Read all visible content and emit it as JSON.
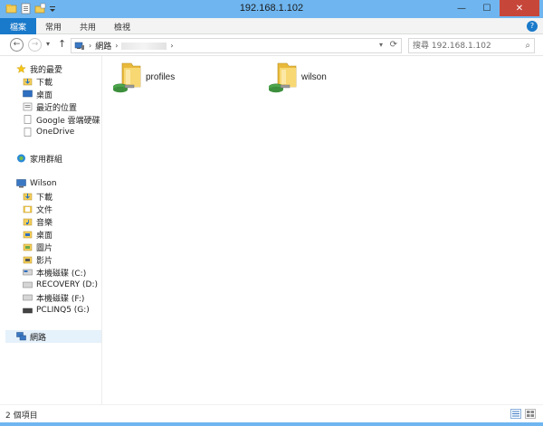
{
  "window": {
    "title": "192.168.1.102",
    "minimize": "—",
    "maximize": "☐",
    "close": "✕"
  },
  "ribbon": {
    "tabs": [
      "檔案",
      "常用",
      "共用",
      "檢視"
    ],
    "help": "?"
  },
  "navbar": {
    "back": "←",
    "forward": "→",
    "recent": "▾",
    "up": "↑",
    "address_root": "網路",
    "chevron": "›",
    "search_placeholder": "搜尋 192.168.1.102"
  },
  "sidebar": {
    "favorites": "我的最愛",
    "fav_items": [
      "下載",
      "桌面",
      "最近的位置",
      "Google 雲端硬碟",
      "OneDrive"
    ],
    "homegroup": "家用群組",
    "this_pc": "Wilson",
    "pc_items": [
      "下載",
      "文件",
      "音樂",
      "桌面",
      "圖片",
      "影片",
      "本機磁碟 (C:)",
      "RECOVERY (D:)",
      "本機磁碟 (F:)",
      "PCLINQ5 (G:)"
    ],
    "network": "網路"
  },
  "content": {
    "items": [
      {
        "name": "profiles"
      },
      {
        "name": "wilson"
      }
    ]
  },
  "status": {
    "count": "2 個項目"
  },
  "colors": {
    "accent": "#1979ca",
    "titlebar": "#6fb6f0",
    "close": "#c7463a",
    "folder": "#f3cf5a"
  }
}
